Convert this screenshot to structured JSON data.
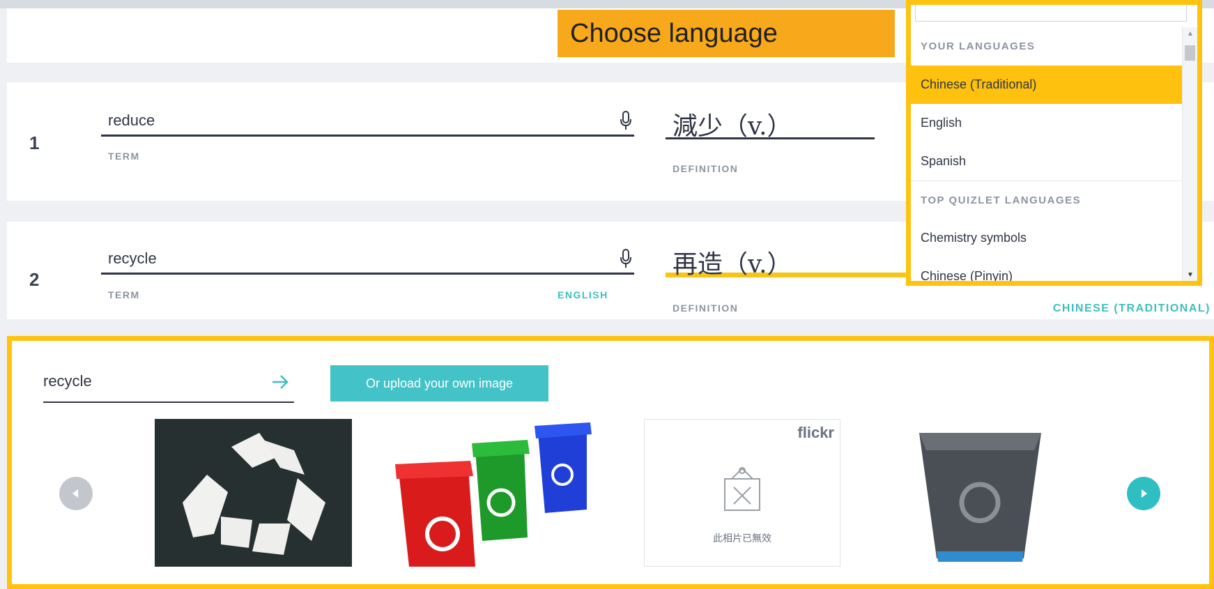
{
  "top_band": {
    "faded_text": ""
  },
  "cards": [
    {
      "index": "1",
      "term": "reduce",
      "term_label": "TERM",
      "term_language": "",
      "definition": "減少（v.）",
      "definition_label": "DEFINITION",
      "definition_language": ""
    },
    {
      "index": "2",
      "term": "recycle",
      "term_label": "TERM",
      "term_language": "ENGLISH",
      "definition": "再造（v.）",
      "definition_label": "DEFINITION",
      "definition_language": "CHINESE (TRADITIONAL)"
    }
  ],
  "image_panel": {
    "search_value": "recycle",
    "upload_label": "Or upload your own image",
    "flickr_label": "flickr",
    "broken_image_text": "此相片已無效"
  },
  "callout": {
    "text": "Choose language"
  },
  "language_dropdown": {
    "search_value": "",
    "groups": [
      {
        "heading": "YOUR LANGUAGES",
        "items": [
          "Chinese (Traditional)",
          "English",
          "Spanish"
        ]
      },
      {
        "heading": "TOP QUIZLET LANGUAGES",
        "items": [
          "Chemistry symbols",
          "Chinese (Pinyin)"
        ]
      }
    ],
    "selected": "Chinese (Traditional)"
  },
  "colors": {
    "accent_teal": "#43c2c7",
    "highlight_yellow": "#ffc20e",
    "callout_orange": "#f7a81b",
    "text_dark": "#303545"
  }
}
